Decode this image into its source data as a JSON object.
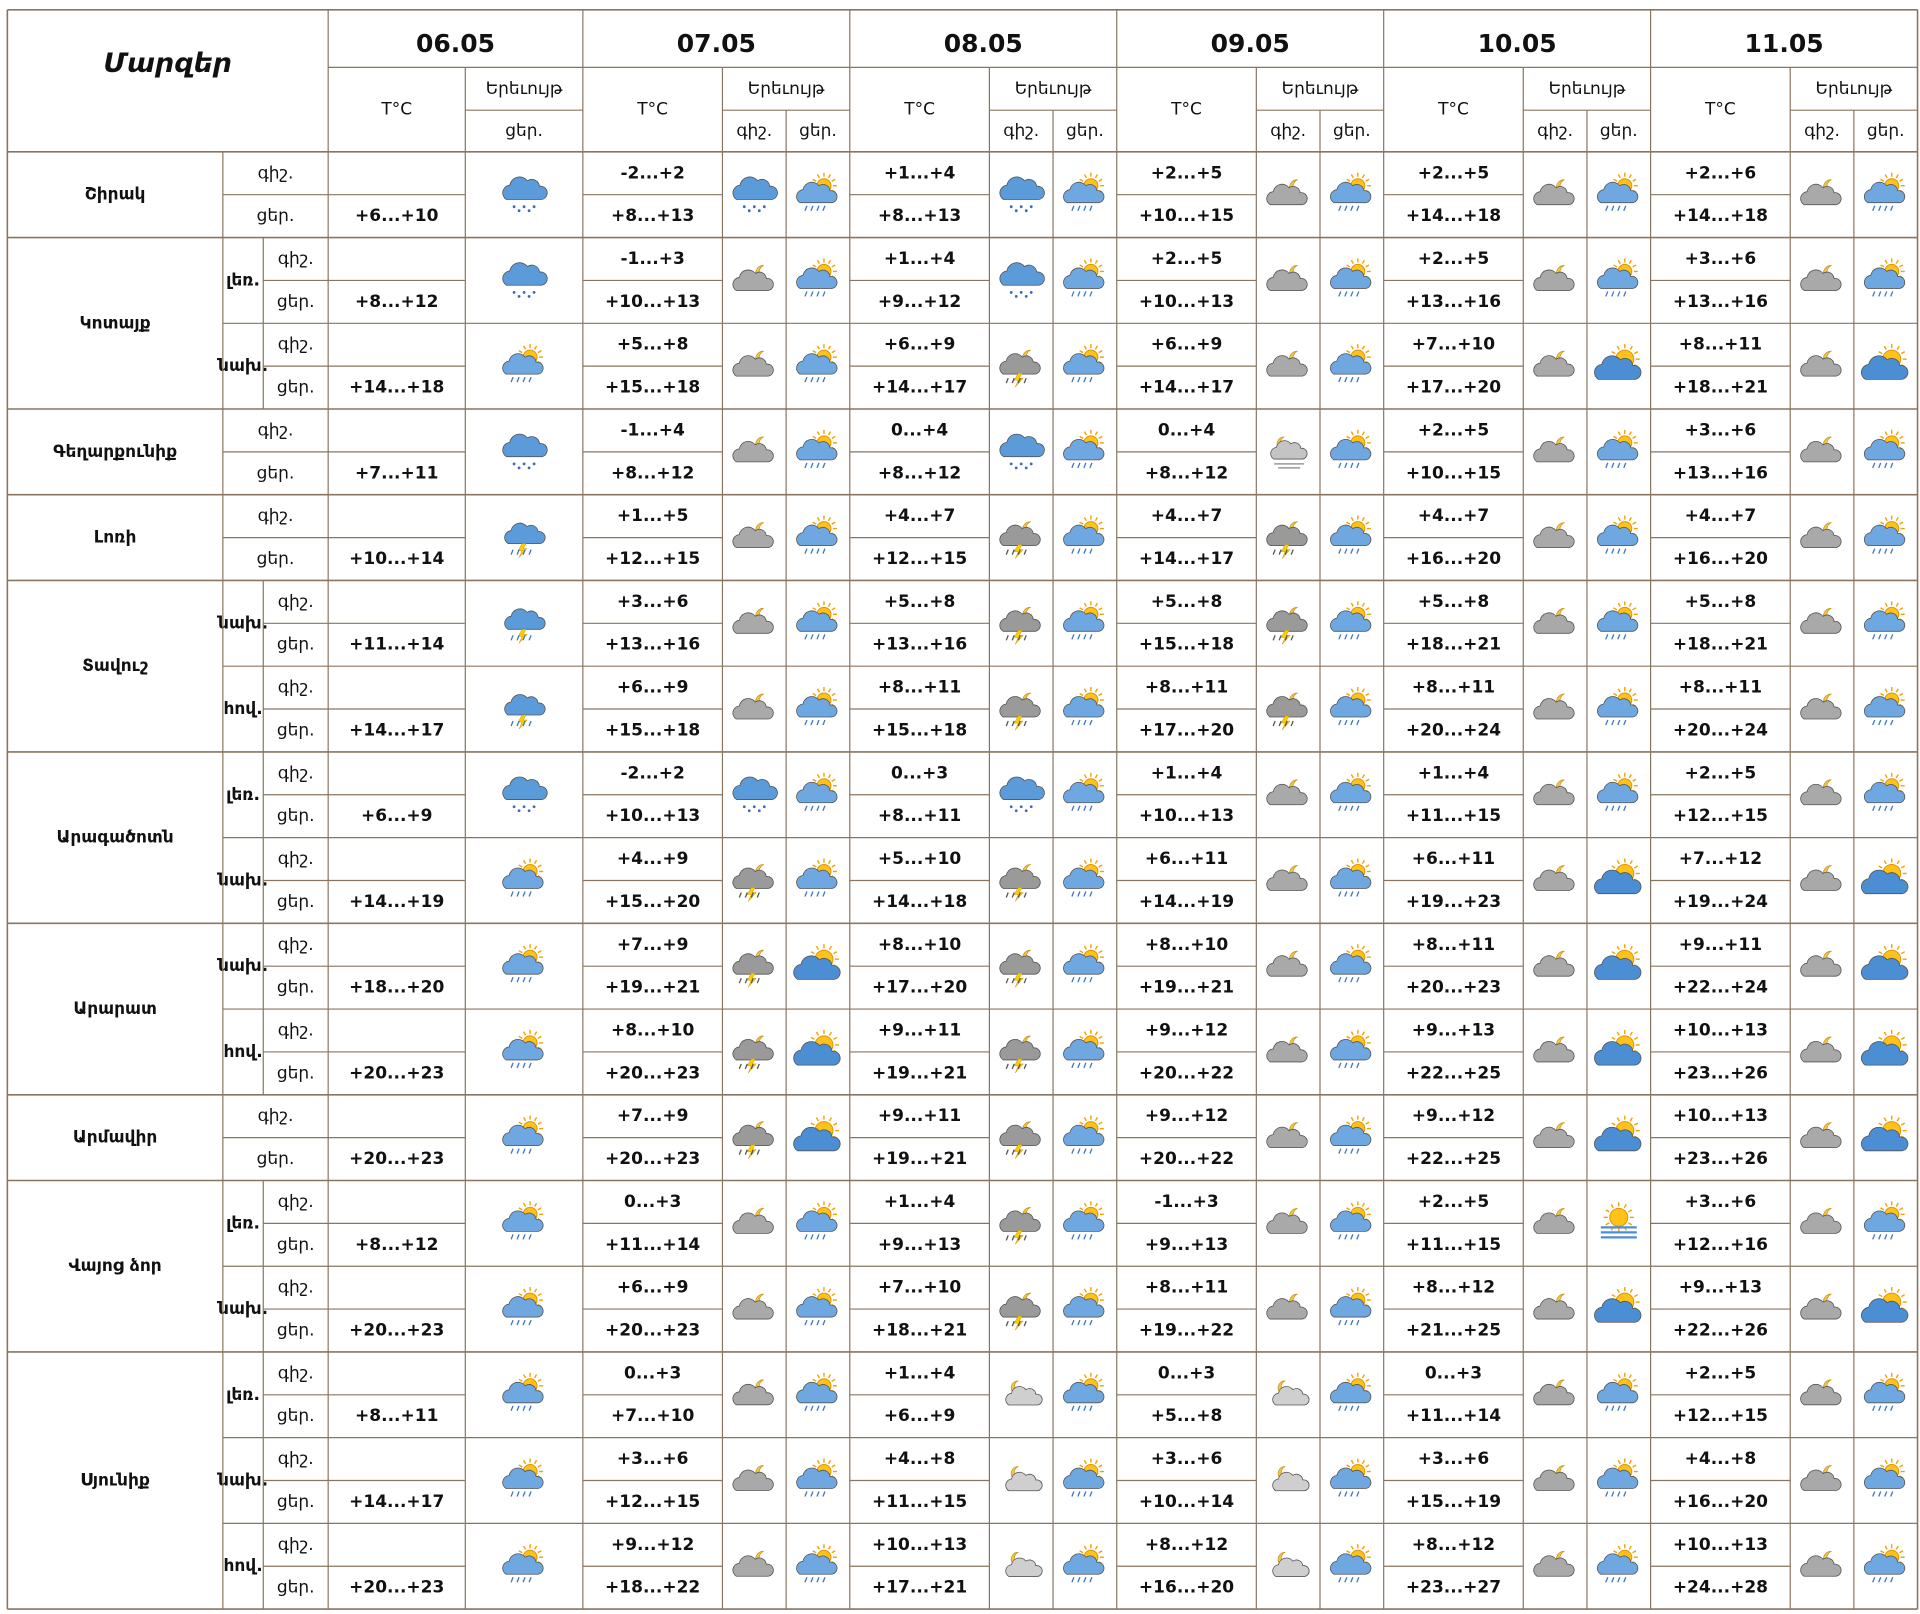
{
  "table": {
    "title": "Մարզեր",
    "temp_header": "T°C",
    "weather_header": "Երեւույթ",
    "night": "գիշ.",
    "day": "ցեր.",
    "dates": [
      "06.05",
      "07.05",
      "08.05",
      "09.05",
      "10.05",
      "11.05"
    ],
    "regions": [
      {
        "name": "Շիրակ",
        "zones": [
          {
            "zone": "",
            "t06": "+6...+10",
            "w06": "cloud-snow-icon",
            "nights": [
              "-2...+2",
              "+1...+4",
              "+2...+5",
              "+2...+5",
              "+2...+6"
            ],
            "days": [
              "+8...+13",
              "+8...+13",
              "+10...+15",
              "+14...+18",
              "+14...+18"
            ],
            "wn": [
              "cloud-snow-icon",
              "cloud-snow-icon",
              "cloud-moon-icon",
              "cloud-moon-icon",
              "cloud-moon-icon"
            ],
            "wd": [
              "sun-cloud-rain-icon",
              "sun-cloud-rain-icon",
              "sun-cloud-rain-icon",
              "sun-cloud-rain-icon",
              "sun-cloud-rain-icon"
            ]
          }
        ]
      },
      {
        "name": "Կոտայք",
        "zones": [
          {
            "zone": "լեռ.",
            "t06": "+8...+12",
            "w06": "cloud-snow-icon",
            "nights": [
              "-1...+3",
              "+1...+4",
              "+2...+5",
              "+2...+5",
              "+3...+6"
            ],
            "days": [
              "+10...+13",
              "+9...+12",
              "+10...+13",
              "+13...+16",
              "+13...+16"
            ],
            "wn": [
              "cloud-moon-icon",
              "cloud-snow-icon",
              "cloud-moon-icon",
              "cloud-moon-icon",
              "cloud-moon-icon"
            ],
            "wd": [
              "sun-cloud-rain-icon",
              "sun-cloud-rain-icon",
              "sun-cloud-rain-icon",
              "sun-cloud-rain-icon",
              "sun-cloud-rain-icon"
            ]
          },
          {
            "zone": "նախ.",
            "t06": "+14...+18",
            "w06": "sun-cloud-rain-icon",
            "nights": [
              "+5...+8",
              "+6...+9",
              "+6...+9",
              "+7...+10",
              "+8...+11"
            ],
            "days": [
              "+15...+18",
              "+14...+17",
              "+14...+17",
              "+17...+20",
              "+18...+21"
            ],
            "wn": [
              "cloud-moon-icon",
              "moon-cloud-storm-icon",
              "cloud-moon-icon",
              "cloud-moon-icon",
              "cloud-moon-icon"
            ],
            "wd": [
              "sun-cloud-rain-icon",
              "sun-cloud-rain-icon",
              "sun-cloud-rain-icon",
              "sun-cloud-icon",
              "sun-cloud-icon"
            ]
          }
        ]
      },
      {
        "name": "Գեղարքունիք",
        "zones": [
          {
            "zone": "",
            "t06": "+7...+11",
            "w06": "cloud-snow-icon",
            "nights": [
              "-1...+4",
              "0...+4",
              "0...+4",
              "+2...+5",
              "+3...+6"
            ],
            "days": [
              "+8...+12",
              "+8...+12",
              "+8...+12",
              "+10...+15",
              "+13...+16"
            ],
            "wn": [
              "cloud-moon-icon",
              "cloud-snow-icon",
              "moon-fog-icon",
              "cloud-moon-icon",
              "cloud-moon-icon"
            ],
            "wd": [
              "sun-cloud-rain-icon",
              "sun-cloud-rain-icon",
              "sun-cloud-rain-icon",
              "sun-cloud-rain-icon",
              "sun-cloud-rain-icon"
            ]
          }
        ]
      },
      {
        "name": "Լոռի",
        "zones": [
          {
            "zone": "",
            "t06": "+10...+14",
            "w06": "cloud-storm-icon",
            "nights": [
              "+1...+5",
              "+4...+7",
              "+4...+7",
              "+4...+7",
              "+4...+7"
            ],
            "days": [
              "+12...+15",
              "+12...+15",
              "+14...+17",
              "+16...+20",
              "+16...+20"
            ],
            "wn": [
              "cloud-moon-icon",
              "moon-cloud-storm-icon",
              "moon-cloud-storm-icon",
              "cloud-moon-icon",
              "cloud-moon-icon"
            ],
            "wd": [
              "sun-cloud-rain-icon",
              "sun-cloud-rain-icon",
              "sun-cloud-rain-icon",
              "sun-cloud-rain-icon",
              "sun-cloud-rain-icon"
            ]
          }
        ]
      },
      {
        "name": "Տավուշ",
        "zones": [
          {
            "zone": "նախ.",
            "t06": "+11...+14",
            "w06": "cloud-storm-icon",
            "nights": [
              "+3...+6",
              "+5...+8",
              "+5...+8",
              "+5...+8",
              "+5...+8"
            ],
            "days": [
              "+13...+16",
              "+13...+16",
              "+15...+18",
              "+18...+21",
              "+18...+21"
            ],
            "wn": [
              "cloud-moon-icon",
              "moon-cloud-storm-icon",
              "moon-cloud-storm-icon",
              "cloud-moon-icon",
              "cloud-moon-icon"
            ],
            "wd": [
              "sun-cloud-rain-icon",
              "sun-cloud-rain-icon",
              "sun-cloud-rain-icon",
              "sun-cloud-rain-icon",
              "sun-cloud-rain-icon"
            ]
          },
          {
            "zone": "հով.",
            "t06": "+14...+17",
            "w06": "cloud-storm-icon",
            "nights": [
              "+6...+9",
              "+8...+11",
              "+8...+11",
              "+8...+11",
              "+8...+11"
            ],
            "days": [
              "+15...+18",
              "+15...+18",
              "+17...+20",
              "+20...+24",
              "+20...+24"
            ],
            "wn": [
              "cloud-moon-icon",
              "moon-cloud-storm-icon",
              "moon-cloud-storm-icon",
              "cloud-moon-icon",
              "cloud-moon-icon"
            ],
            "wd": [
              "sun-cloud-rain-icon",
              "sun-cloud-rain-icon",
              "sun-cloud-rain-icon",
              "sun-cloud-rain-icon",
              "sun-cloud-rain-icon"
            ]
          }
        ]
      },
      {
        "name": "Արագածոտն",
        "zones": [
          {
            "zone": "լեռ.",
            "t06": "+6...+9",
            "w06": "cloud-snow-icon",
            "nights": [
              "-2...+2",
              "0...+3",
              "+1...+4",
              "+1...+4",
              "+2...+5"
            ],
            "days": [
              "+10...+13",
              "+8...+11",
              "+10...+13",
              "+11...+15",
              "+12...+15"
            ],
            "wn": [
              "cloud-snow-icon",
              "cloud-snow-icon",
              "cloud-moon-icon",
              "cloud-moon-icon",
              "cloud-moon-icon"
            ],
            "wd": [
              "sun-cloud-rain-icon",
              "sun-cloud-rain-icon",
              "sun-cloud-rain-icon",
              "sun-cloud-rain-icon",
              "sun-cloud-rain-icon"
            ]
          },
          {
            "zone": "նախ.",
            "t06": "+14...+19",
            "w06": "sun-cloud-rain-icon",
            "nights": [
              "+4...+9",
              "+5...+10",
              "+6...+11",
              "+6...+11",
              "+7...+12"
            ],
            "days": [
              "+15...+20",
              "+14...+18",
              "+14...+19",
              "+19...+23",
              "+19...+24"
            ],
            "wn": [
              "moon-cloud-storm-icon",
              "moon-cloud-storm-icon",
              "cloud-moon-icon",
              "cloud-moon-icon",
              "cloud-moon-icon"
            ],
            "wd": [
              "sun-cloud-rain-icon",
              "sun-cloud-rain-icon",
              "sun-cloud-rain-icon",
              "sun-cloud-icon",
              "sun-cloud-icon"
            ]
          }
        ]
      },
      {
        "name": "Արարատ",
        "zones": [
          {
            "zone": "նախ.",
            "t06": "+18...+20",
            "w06": "sun-cloud-rain-icon",
            "nights": [
              "+7...+9",
              "+8...+10",
              "+8...+10",
              "+8...+11",
              "+9...+11"
            ],
            "days": [
              "+19...+21",
              "+17...+20",
              "+19...+21",
              "+20...+23",
              "+22...+24"
            ],
            "wn": [
              "moon-cloud-storm-icon",
              "moon-cloud-storm-icon",
              "cloud-moon-icon",
              "cloud-moon-icon",
              "cloud-moon-icon"
            ],
            "wd": [
              "sun-cloud-icon",
              "sun-cloud-rain-icon",
              "sun-cloud-rain-icon",
              "sun-cloud-icon",
              "sun-cloud-icon"
            ]
          },
          {
            "zone": "հով.",
            "t06": "+20...+23",
            "w06": "sun-cloud-rain-icon",
            "nights": [
              "+8...+10",
              "+9...+11",
              "+9...+12",
              "+9...+13",
              "+10...+13"
            ],
            "days": [
              "+20...+23",
              "+19...+21",
              "+20...+22",
              "+22...+25",
              "+23...+26"
            ],
            "wn": [
              "moon-cloud-storm-icon",
              "moon-cloud-storm-icon",
              "cloud-moon-icon",
              "cloud-moon-icon",
              "cloud-moon-icon"
            ],
            "wd": [
              "sun-cloud-icon",
              "sun-cloud-rain-icon",
              "sun-cloud-rain-icon",
              "sun-cloud-icon",
              "sun-cloud-icon"
            ]
          }
        ]
      },
      {
        "name": "Արմավիր",
        "zones": [
          {
            "zone": "",
            "t06": "+20...+23",
            "w06": "sun-cloud-rain-icon",
            "nights": [
              "+7...+9",
              "+9...+11",
              "+9...+12",
              "+9...+12",
              "+10...+13"
            ],
            "days": [
              "+20...+23",
              "+19...+21",
              "+20...+22",
              "+22...+25",
              "+23...+26"
            ],
            "wn": [
              "moon-cloud-storm-icon",
              "moon-cloud-storm-icon",
              "cloud-moon-icon",
              "cloud-moon-icon",
              "cloud-moon-icon"
            ],
            "wd": [
              "sun-cloud-icon",
              "sun-cloud-rain-icon",
              "sun-cloud-rain-icon",
              "sun-cloud-icon",
              "sun-cloud-icon"
            ]
          }
        ]
      },
      {
        "name": "Վայոց ձոր",
        "zones": [
          {
            "zone": "լեռ.",
            "t06": "+8...+12",
            "w06": "sun-cloud-rain-icon",
            "nights": [
              "0...+3",
              "+1...+4",
              "-1...+3",
              "+2...+5",
              "+3...+6"
            ],
            "days": [
              "+11...+14",
              "+9...+13",
              "+9...+13",
              "+11...+15",
              "+12...+16"
            ],
            "wn": [
              "cloud-moon-icon",
              "moon-cloud-storm-icon",
              "cloud-moon-icon",
              "cloud-moon-icon",
              "cloud-moon-icon"
            ],
            "wd": [
              "sun-cloud-rain-icon",
              "sun-cloud-rain-icon",
              "sun-cloud-rain-icon",
              "sun-fog-icon",
              "sun-cloud-rain-icon"
            ]
          },
          {
            "zone": "նախ.",
            "t06": "+20...+23",
            "w06": "sun-cloud-rain-icon",
            "nights": [
              "+6...+9",
              "+7...+10",
              "+8...+11",
              "+8...+12",
              "+9...+13"
            ],
            "days": [
              "+20...+23",
              "+18...+21",
              "+19...+22",
              "+21...+25",
              "+22...+26"
            ],
            "wn": [
              "cloud-moon-icon",
              "moon-cloud-storm-icon",
              "cloud-moon-icon",
              "cloud-moon-icon",
              "cloud-moon-icon"
            ],
            "wd": [
              "sun-cloud-rain-icon",
              "sun-cloud-rain-icon",
              "sun-cloud-rain-icon",
              "sun-cloud-icon",
              "sun-cloud-icon"
            ]
          }
        ]
      },
      {
        "name": "Սյունիք",
        "zones": [
          {
            "zone": "լեռ.",
            "t06": "+8...+11",
            "w06": "sun-cloud-rain-icon",
            "nights": [
              "0...+3",
              "+1...+4",
              "0...+3",
              "0...+3",
              "+2...+5"
            ],
            "days": [
              "+7...+10",
              "+6...+9",
              "+5...+8",
              "+11...+14",
              "+12...+15"
            ],
            "wn": [
              "cloud-moon-icon",
              "moon-cloud-light-icon",
              "moon-cloud-light-icon",
              "cloud-moon-icon",
              "cloud-moon-icon"
            ],
            "wd": [
              "sun-cloud-rain-icon",
              "sun-cloud-rain-icon",
              "sun-cloud-rain-icon",
              "sun-cloud-rain-icon",
              "sun-cloud-rain-icon"
            ]
          },
          {
            "zone": "նախ.",
            "t06": "+14...+17",
            "w06": "sun-cloud-rain-icon",
            "nights": [
              "+3...+6",
              "+4...+8",
              "+3...+6",
              "+3...+6",
              "+4...+8"
            ],
            "days": [
              "+12...+15",
              "+11...+15",
              "+10...+14",
              "+15...+19",
              "+16...+20"
            ],
            "wn": [
              "cloud-moon-icon",
              "moon-cloud-light-icon",
              "moon-cloud-light-icon",
              "cloud-moon-icon",
              "cloud-moon-icon"
            ],
            "wd": [
              "sun-cloud-rain-icon",
              "sun-cloud-rain-icon",
              "sun-cloud-rain-icon",
              "sun-cloud-rain-icon",
              "sun-cloud-rain-icon"
            ]
          },
          {
            "zone": "հով.",
            "t06": "+20...+23",
            "w06": "sun-cloud-rain-icon",
            "nights": [
              "+9...+12",
              "+10...+13",
              "+8...+12",
              "+8...+12",
              "+10...+13"
            ],
            "days": [
              "+18...+22",
              "+17...+21",
              "+16...+20",
              "+23...+27",
              "+24...+28"
            ],
            "wn": [
              "cloud-moon-icon",
              "moon-cloud-light-icon",
              "moon-cloud-light-icon",
              "cloud-moon-icon",
              "cloud-moon-icon"
            ],
            "wd": [
              "sun-cloud-rain-icon",
              "sun-cloud-rain-icon",
              "sun-cloud-rain-icon",
              "sun-cloud-rain-icon",
              "sun-cloud-rain-icon"
            ]
          }
        ]
      }
    ]
  }
}
